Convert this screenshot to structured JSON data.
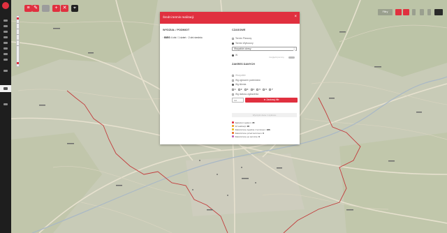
{
  "modal": {
    "title": "Średni termin realizacji",
    "close": "×",
    "left_heading": "WYDZIAŁ / PODMIOT",
    "right_heading": "CZASOWE",
    "row": {
      "expander": "›",
      "name": "BIEG",
      "value": "4 dni / 1 dzień · 2 dni",
      "extra": "średnio"
    },
    "options": [
      {
        "label": "Termin Planowy",
        "kind": "box",
        "on": false
      },
      {
        "label": "Termin Wyliczony",
        "kind": "radio",
        "on": true
      }
    ],
    "select_value": "Wszystkie okresy",
    "radio_inline": "W",
    "toggle_label": "Uwzględnij terminy",
    "sub_heading": "ZAKRES DANYCH",
    "sub_options": [
      {
        "label": "Wszystkie",
        "dim": true
      },
      {
        "label": "Wg zgłoszeń podmiotów",
        "dim": false
      },
      {
        "label": "Wg klienta",
        "dim": false
      }
    ],
    "fields": [
      "1",
      "2",
      "3",
      "4",
      "5",
      "6",
      "7"
    ],
    "status_label": "Wg statusu zgłoszenia",
    "small_input": "Od",
    "apply_button": "★ Zastosuj filtr",
    "secondary_button": "Wyczyść dane z wykresu",
    "legend": [
      {
        "label": "Zgłoszeń ogółem:",
        "value": "35",
        "color": "#e0303f"
      },
      {
        "label": "W realizacji:",
        "value": "28",
        "color": "#f0a020"
      },
      {
        "label": "Zakończone zgodnie z terminem:",
        "value": "186",
        "color": "#e6c020"
      },
      {
        "label": "Zakończone przed terminem:",
        "value": "0",
        "color": "#e87020"
      },
      {
        "label": "Zakończone po terminie:",
        "value": "0",
        "color": "#c060b0"
      }
    ]
  },
  "toolbar": {
    "filter_tag": "Filtry",
    "plus": "+",
    "close": "✕",
    "pin": "⌖"
  }
}
